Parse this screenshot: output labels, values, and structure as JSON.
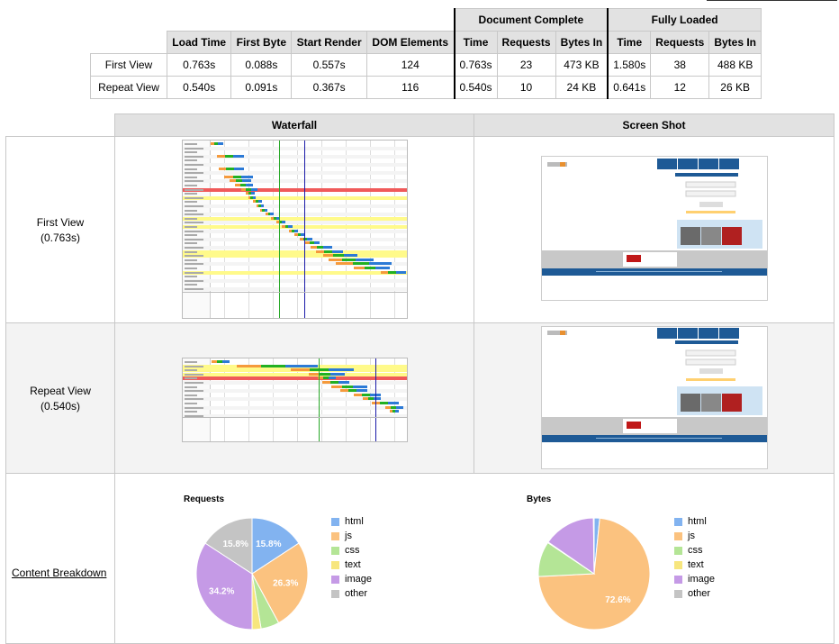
{
  "results": {
    "groups": {
      "document_complete": "Document Complete",
      "fully_loaded": "Fully Loaded"
    },
    "headers": [
      "Load Time",
      "First Byte",
      "Start Render",
      "DOM Elements",
      "Time",
      "Requests",
      "Bytes In",
      "Time",
      "Requests",
      "Bytes In"
    ],
    "rows": [
      {
        "label": "First View",
        "values": [
          "0.763s",
          "0.088s",
          "0.557s",
          "124",
          "0.763s",
          "23",
          "473 KB",
          "1.580s",
          "38",
          "488 KB"
        ]
      },
      {
        "label": "Repeat View",
        "values": [
          "0.540s",
          "0.091s",
          "0.367s",
          "116",
          "0.540s",
          "10",
          "24 KB",
          "0.641s",
          "12",
          "26 KB"
        ]
      }
    ]
  },
  "grid": {
    "waterfall_header": "Waterfall",
    "screenshot_header": "Screen Shot",
    "first_view_label": "First View",
    "first_view_time": "(0.763s)",
    "repeat_view_label": "Repeat View",
    "repeat_view_time": "(0.540s)",
    "content_breakdown": "Content Breakdown"
  },
  "colors": {
    "html": "#82b3f0",
    "js": "#fbc27f",
    "css": "#b4e596",
    "text": "#f7e67e",
    "image": "#c59ae6",
    "other": "#c4c4c4",
    "highlight_yellow": "#fffa8a",
    "error_red": "#f05a5a",
    "render_green": "#28a828",
    "doc_complete_blue": "#1a1aa8"
  },
  "charts": {
    "chart_data": [
      {
        "type": "pie",
        "title": "Requests",
        "categories": [
          "html",
          "js",
          "css",
          "text",
          "image",
          "other"
        ],
        "values": [
          15.8,
          26.3,
          5.3,
          2.6,
          34.2,
          15.8
        ],
        "labels": [
          "15.8%",
          "26.3%",
          "",
          "",
          "34.2%",
          "15.8%"
        ]
      },
      {
        "type": "pie",
        "title": "Bytes",
        "categories": [
          "html",
          "js",
          "css",
          "text",
          "image",
          "other"
        ],
        "values": [
          1.6,
          72.6,
          10.2,
          0.2,
          15.2,
          0.2
        ],
        "labels": [
          "",
          "72.6%",
          "",
          "",
          "",
          ""
        ]
      }
    ]
  }
}
